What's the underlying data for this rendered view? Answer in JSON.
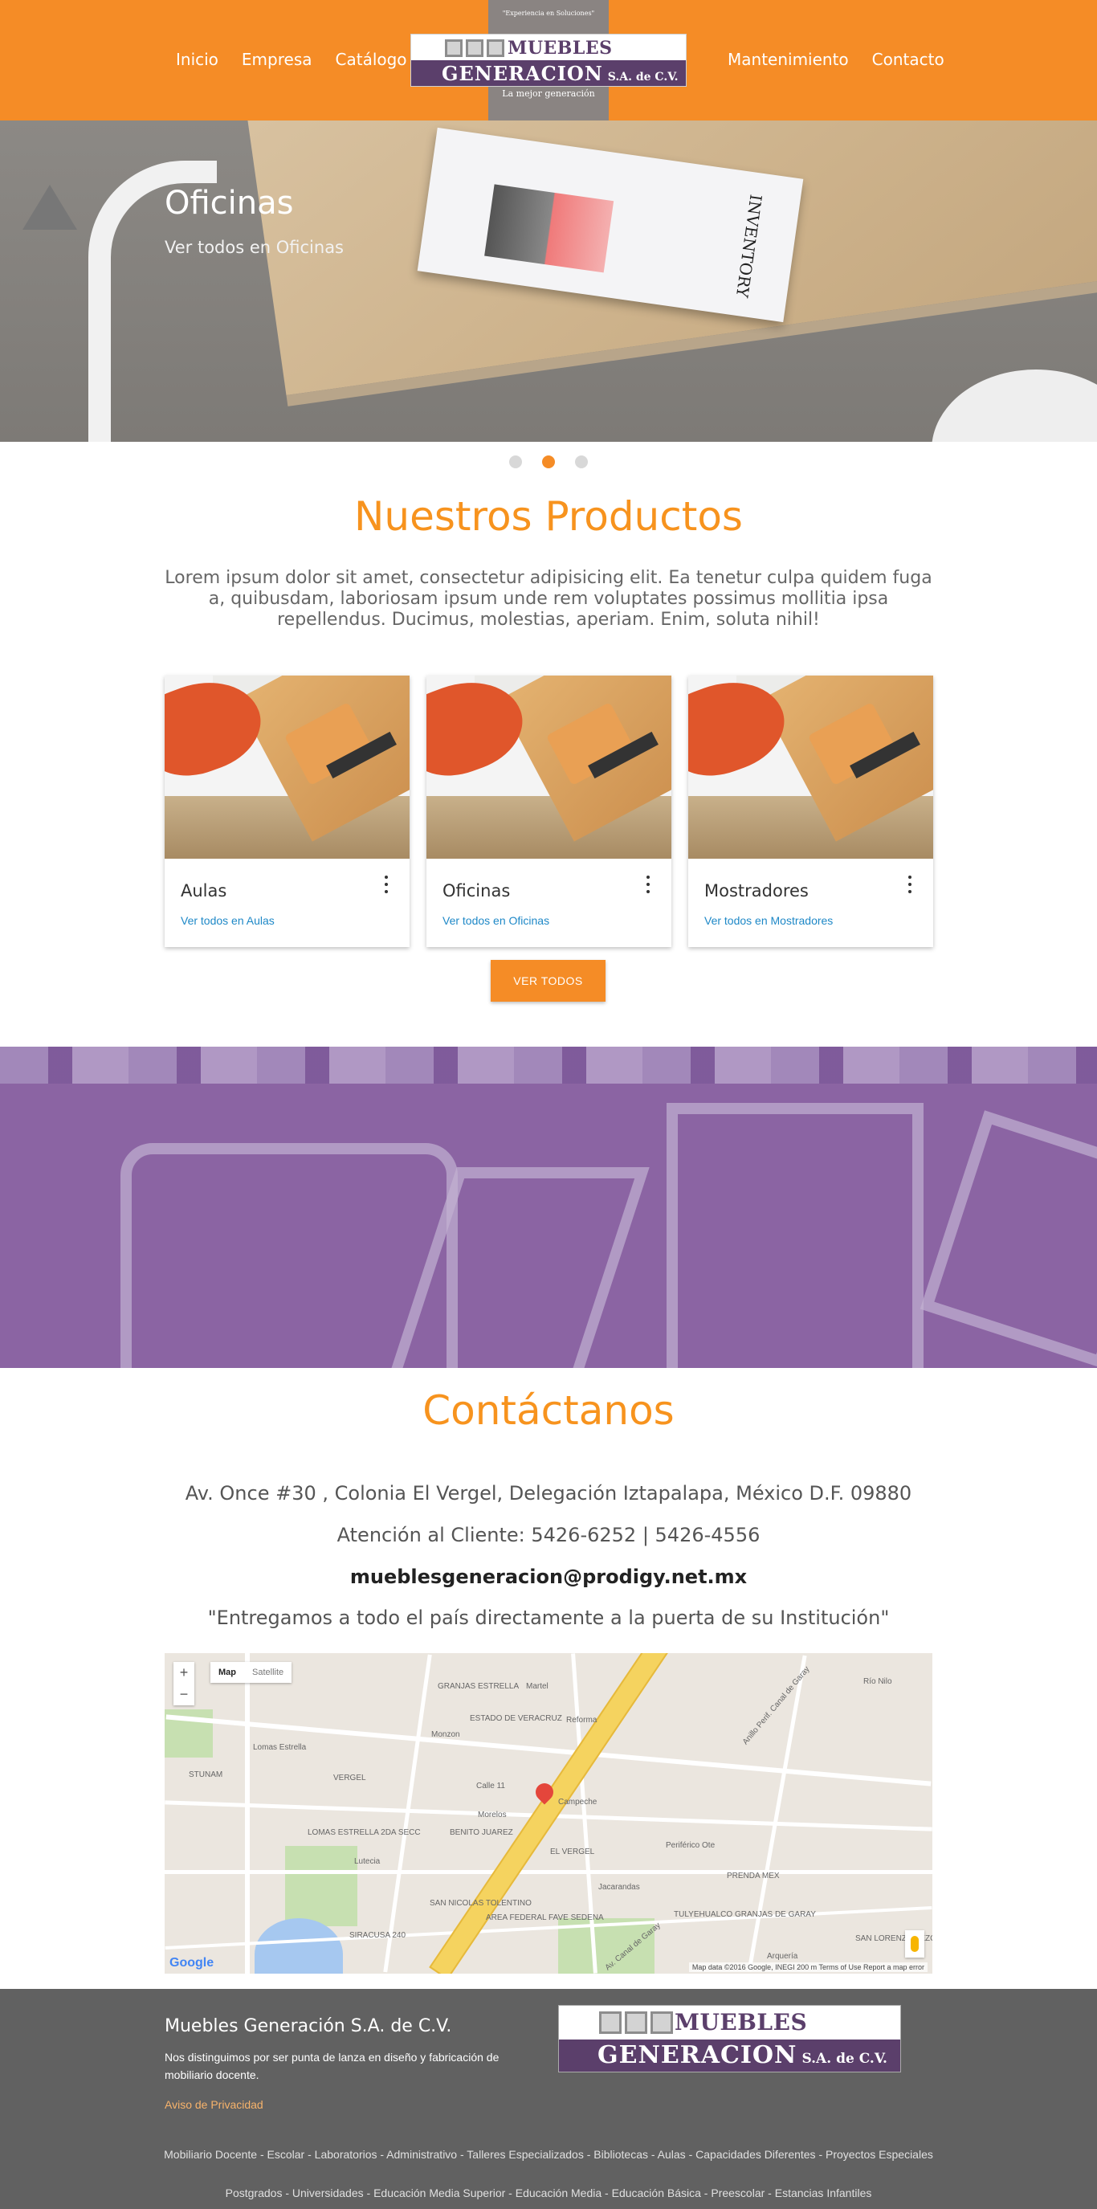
{
  "header": {
    "nav_left": [
      "Inicio",
      "Empresa",
      "Catálogo"
    ],
    "nav_right": [
      "Mantenimiento",
      "Contacto"
    ],
    "logo": {
      "tagline": "\"Experiencia en Soluciones\"",
      "top": "MUEBLES",
      "band": "GENERACION",
      "band_suffix": "S.A. de C.V.",
      "bottom": "La mejor generación"
    }
  },
  "hero": {
    "title": "Oficinas",
    "subtitle": "Ver todos en Oficinas",
    "magazine_title": "INVENTORY",
    "dots": 3,
    "active_dot": 1
  },
  "products": {
    "title": "Nuestros Productos",
    "intro": "Lorem ipsum dolor sit amet, consectetur adipisicing elit. Ea tenetur culpa quidem fuga a, quibusdam, laboriosam ipsum unde rem voluptates possimus mollitia ipsa repellendus. Ducimus, molestias, aperiam. Enim, soluta nihil!",
    "cards": [
      {
        "title": "Aulas",
        "link": "Ver todos en Aulas"
      },
      {
        "title": "Oficinas",
        "link": "Ver todos en Oficinas"
      },
      {
        "title": "Mostradores",
        "link": "Ver todos en Mostradores"
      }
    ],
    "button": "VER TODOS"
  },
  "contact": {
    "title": "Contáctanos",
    "address": "Av. Once #30 , Colonia El Vergel, Delegación Iztapalapa, México D.F. 09880",
    "phone": "Atención al Cliente: 5426-6252 | 5426-4556",
    "email": "mueblesgeneracion@prodigy.net.mx",
    "quote": "\"Entregamos a todo el país directamente a la puerta de su Institución\""
  },
  "map": {
    "zoom_in": "+",
    "zoom_out": "−",
    "type_map": "Map",
    "type_satellite": "Satellite",
    "google": "Google",
    "footer": "Map data ©2016 Google, INEGI   200 m   Terms of Use   Report a map error",
    "labels": [
      "GRANJAS ESTRELLA",
      "ESTADO DE VERACRUZ",
      "Reforma",
      "Martel",
      "Monzon",
      "Lomas Estrella",
      "Calle 11",
      "LOMAS ESTRELLA 2DA SECC",
      "BENITO JUAREZ",
      "EL VERGEL",
      "Periférico Ote",
      "PRENDA MEX",
      "SAN NICOLAS TOLENTINO",
      "AREA FEDERAL FAVE SEDENA",
      "SIRACUSA 240",
      "TULYEHUALCO GRANJAS DE GARAY",
      "SAN LORENZO TEZONCO",
      "Av. Canal de Garay",
      "Anillo Perif. Canal de Garay",
      "Lutecia",
      "Morelos",
      "VERGEL",
      "STUNAM",
      "Río Nilo",
      "Jacarandas",
      "Arquería",
      "Campeche"
    ]
  },
  "footer": {
    "title": "Muebles Generación S.A. de C.V.",
    "desc": "Nos distinguimos por ser punta de lanza en diseño y fabricación de mobiliario docente.",
    "privacy": "Aviso de Privacidad",
    "links_row1": [
      "Mobiliario Docente",
      "Escolar",
      "Laboratorios",
      "Administrativo",
      "Talleres Especializados",
      "Bibliotecas",
      "Aulas",
      "Capacidades Diferentes",
      "Proyectos Especiales"
    ],
    "links_row2": [
      "Postgrados",
      "Universidades",
      "Educación Media Superior",
      "Educación Media",
      "Educación Básica",
      "Preescolar",
      "Estancias Infantiles"
    ]
  },
  "colors": {
    "brand_orange": "#f58c26",
    "brand_purple": "#5b3f6b",
    "link_blue": "#1e88c7",
    "footer_gray": "#616161"
  }
}
